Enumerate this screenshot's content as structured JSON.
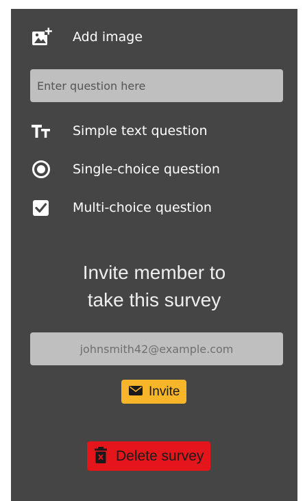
{
  "menu": {
    "add_image": {
      "label": "Add image",
      "icon": "add-image-icon"
    },
    "simple_text": {
      "label": "Simple text question",
      "icon": "text-size-icon"
    },
    "single_choice": {
      "label": "Single-choice question",
      "icon": "radio-button-icon"
    },
    "multi_choice": {
      "label": "Multi-choice question",
      "icon": "checkbox-icon"
    }
  },
  "question": {
    "value": "",
    "placeholder": "Enter question here"
  },
  "invite": {
    "heading": "Invite member to\ntake this survey",
    "email_value": "",
    "email_placeholder": "johnsmith42@example.com",
    "button_label": "Invite",
    "button_icon": "envelope-icon"
  },
  "delete": {
    "button_label": "Delete survey",
    "button_icon": "trash-icon"
  },
  "colors": {
    "panel_bg": "#454545",
    "input_bg": "#bfbfbf",
    "invite_accent": "#f7b52a",
    "delete_accent": "#e5161b"
  }
}
